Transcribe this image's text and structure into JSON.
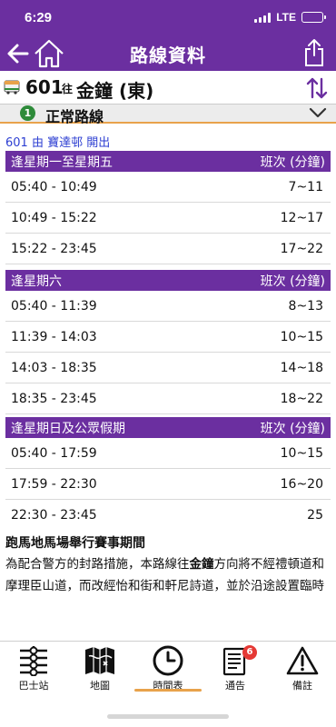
{
  "status": {
    "time": "6:29",
    "network": "LTE"
  },
  "header": {
    "title": "路線資料"
  },
  "route": {
    "number": "601",
    "to_prefix": "往",
    "destination": "金鐘 (東)"
  },
  "normal": {
    "index": "1",
    "label": "正常路線"
  },
  "depart_info": "601 由 寶達邨 開出",
  "sections": [
    {
      "title": "逢星期一至星期五",
      "col": "班次 (分鐘)",
      "rows": [
        {
          "time": "05:40 - 10:49",
          "interval": "7~11"
        },
        {
          "time": "10:49 - 15:22",
          "interval": "12~17"
        },
        {
          "time": "15:22 - 23:45",
          "interval": "17~22"
        }
      ]
    },
    {
      "title": "逢星期六",
      "col": "班次 (分鐘)",
      "rows": [
        {
          "time": "05:40 - 11:39",
          "interval": "8~13"
        },
        {
          "time": "11:39 - 14:03",
          "interval": "10~15"
        },
        {
          "time": "14:03 - 18:35",
          "interval": "14~18"
        },
        {
          "time": "18:35 - 23:45",
          "interval": "18~22"
        }
      ]
    },
    {
      "title": "逢星期日及公眾假期",
      "col": "班次 (分鐘)",
      "rows": [
        {
          "time": "05:40 - 17:59",
          "interval": "10~15"
        },
        {
          "time": "17:59 - 22:30",
          "interval": "16~20"
        },
        {
          "time": "22:30 - 23:45",
          "interval": "25"
        }
      ]
    }
  ],
  "notice": {
    "title": "跑馬地馬場舉行賽事期間",
    "body_pre": "為配合警方的封路措施，本路線往",
    "body_bold": "金鐘",
    "body_post": "方向將不經禮頓道和摩理臣山道，而改經怡和街和軒尼詩道，並於沿途設置臨時巴士站。"
  },
  "tabs": [
    {
      "label": "巴士站",
      "icon": "bus-stop-icon"
    },
    {
      "label": "地圖",
      "icon": "map-icon"
    },
    {
      "label": "時間表",
      "icon": "clock-icon",
      "active": true
    },
    {
      "label": "通告",
      "icon": "notice-icon",
      "badge": "6"
    },
    {
      "label": "備註",
      "icon": "warning-icon"
    }
  ],
  "colors": {
    "primary": "#6b2fa0",
    "accent": "#e8a24b",
    "link": "#2d3fd2",
    "badge": "#e53935",
    "route_ok": "#2e8b3a"
  }
}
